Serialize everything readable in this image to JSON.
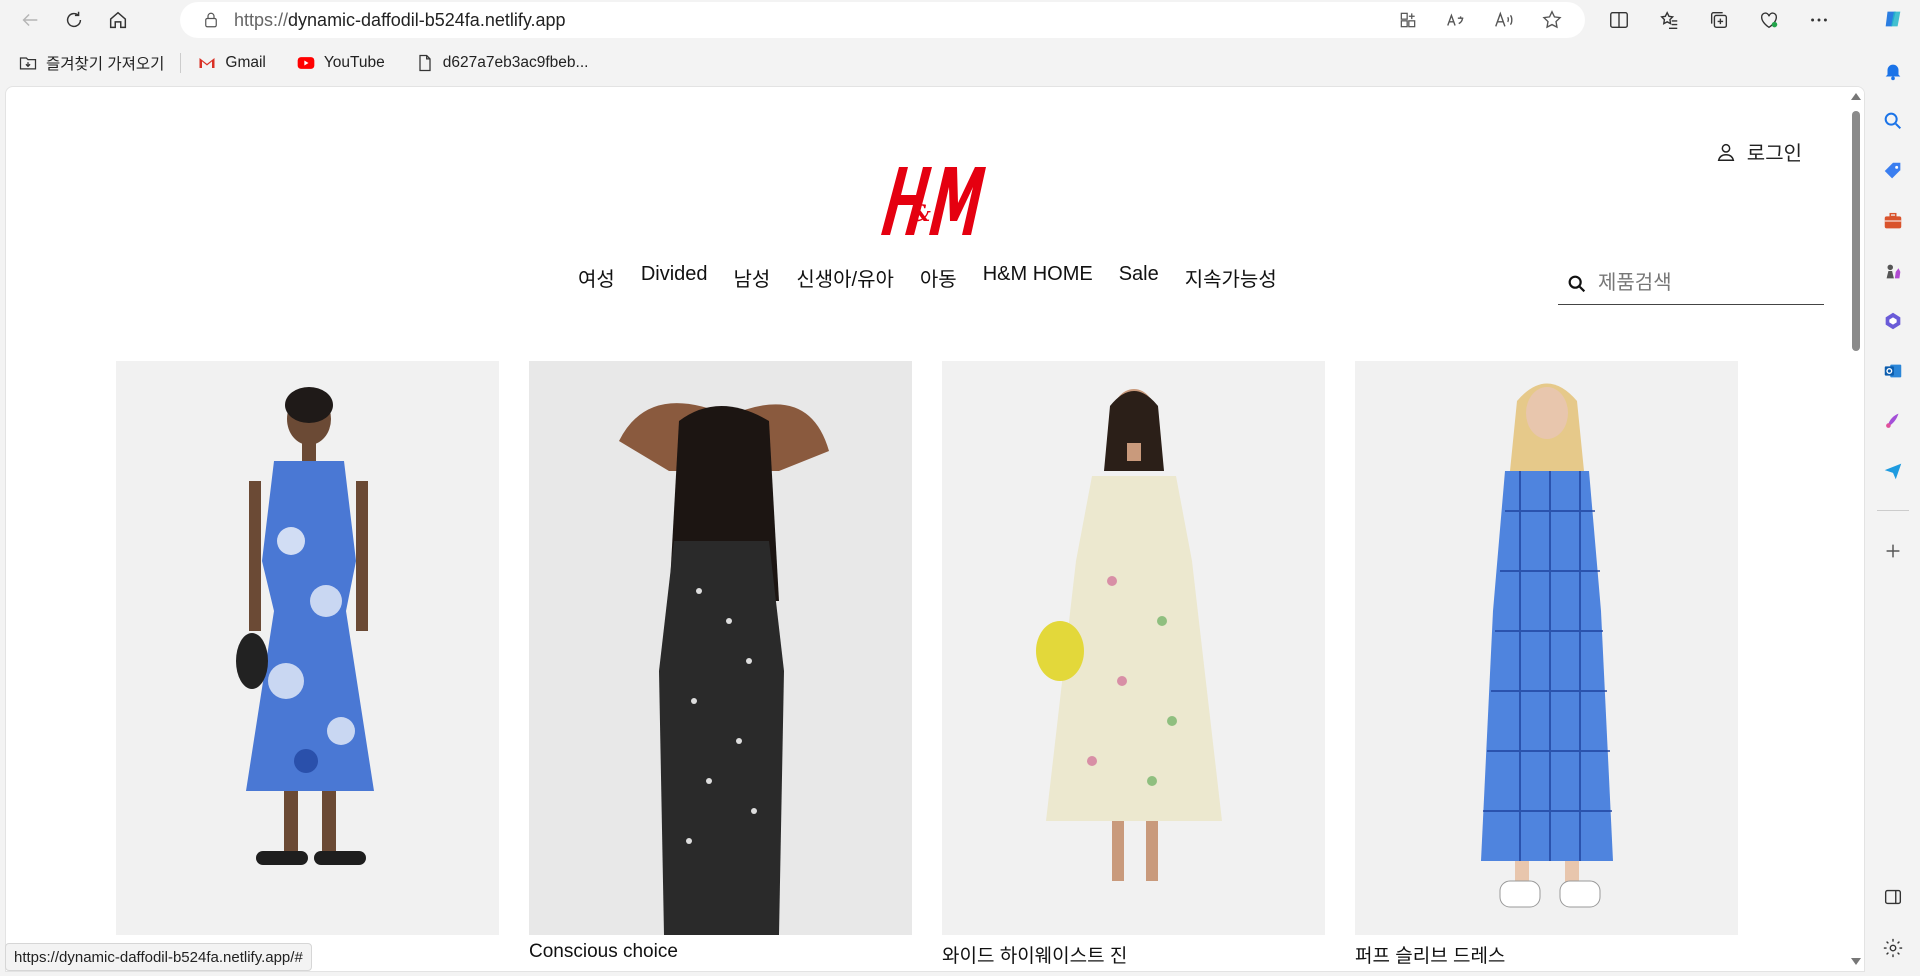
{
  "browser": {
    "url_prefix": "https://",
    "url_host": "dynamic-daffodil-b524fa.netlify.app",
    "status_url": "https://dynamic-daffodil-b524fa.netlify.app/#"
  },
  "bookmarks": [
    {
      "label": "즐겨찾기 가져오기",
      "icon": "import-favorites-icon"
    },
    {
      "label": "Gmail",
      "icon": "gmail-icon"
    },
    {
      "label": "YouTube",
      "icon": "youtube-icon"
    },
    {
      "label": "d627a7eb3ac9fbeb...",
      "icon": "file-icon"
    }
  ],
  "header": {
    "login_label": "로그인",
    "logo_text": "H&M"
  },
  "nav": {
    "items": [
      "여성",
      "Divided",
      "남성",
      "신생아/유아",
      "아동",
      "H&M HOME",
      "Sale",
      "지속가능성"
    ]
  },
  "search": {
    "placeholder": "제품검색"
  },
  "products": [
    {
      "name": "",
      "dress_color": "#4a78d4"
    },
    {
      "name": "Conscious choice",
      "dress_color": "#2a2a2a"
    },
    {
      "name": "와이드 하이웨이스트 진",
      "dress_color": "#ece8cf"
    },
    {
      "name": "퍼프 슬리브 드레스",
      "dress_color": "#4f84de"
    }
  ],
  "colors": {
    "brand_red": "#e50010",
    "edge_blue": "#1a73e8"
  }
}
